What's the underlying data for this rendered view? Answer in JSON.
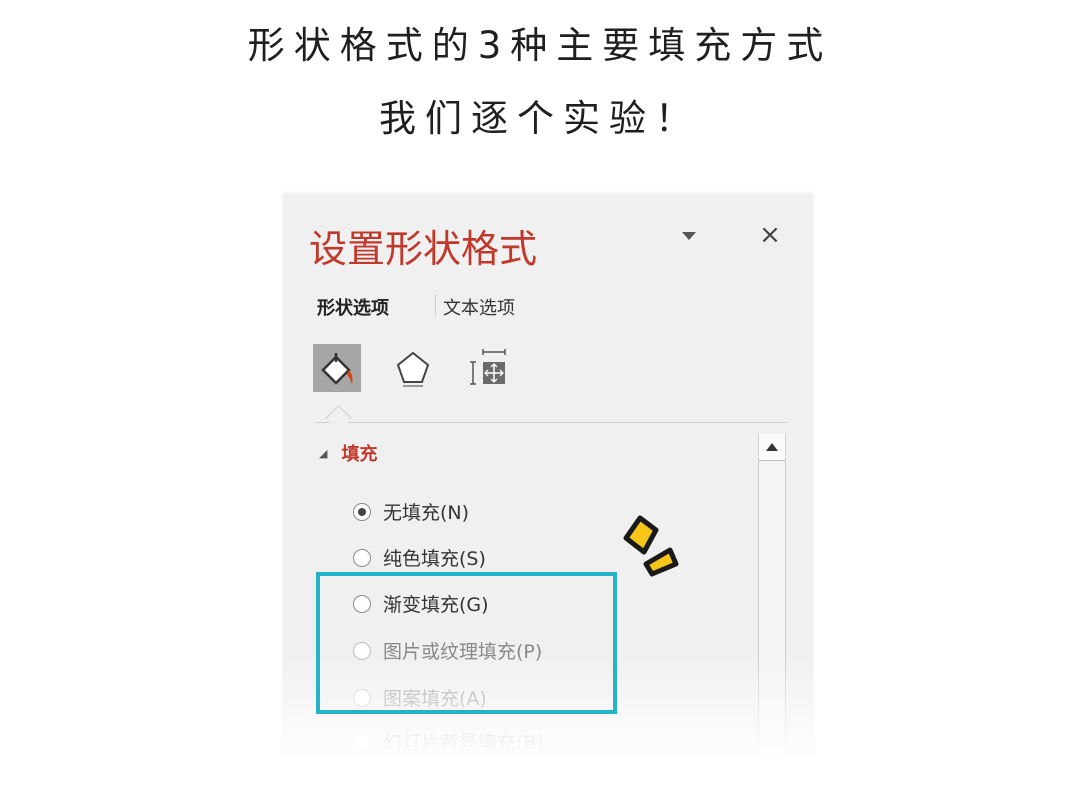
{
  "headings": {
    "line1": "形状格式的3种主要填充方式",
    "line2": "我们逐个实验！"
  },
  "panel": {
    "title": "设置形状格式",
    "close_glyph": "×",
    "tabs": [
      {
        "label": "形状选项",
        "active": true
      },
      {
        "label": "文本选项",
        "active": false
      }
    ],
    "icon_tabs": [
      {
        "icon": "fill-line-icon",
        "active": true
      },
      {
        "icon": "effects-pentagon-icon",
        "active": false
      },
      {
        "icon": "size-properties-icon",
        "active": false
      }
    ],
    "section": {
      "label": "填充",
      "expanded": true
    },
    "options": [
      {
        "label": "无填充(N)",
        "checked": true
      },
      {
        "label": "纯色填充(S)",
        "checked": false
      },
      {
        "label": "渐变填充(G)",
        "checked": false
      },
      {
        "label": "图片或纹理填充(P)",
        "checked": false
      },
      {
        "label": "图案填充(A)",
        "checked": false
      },
      {
        "label": "幻灯片背景填充(B)",
        "checked": false
      }
    ]
  },
  "colors": {
    "title": "#c0392b",
    "highlight": "#23b4c9",
    "sparkle": "#f5c518"
  }
}
